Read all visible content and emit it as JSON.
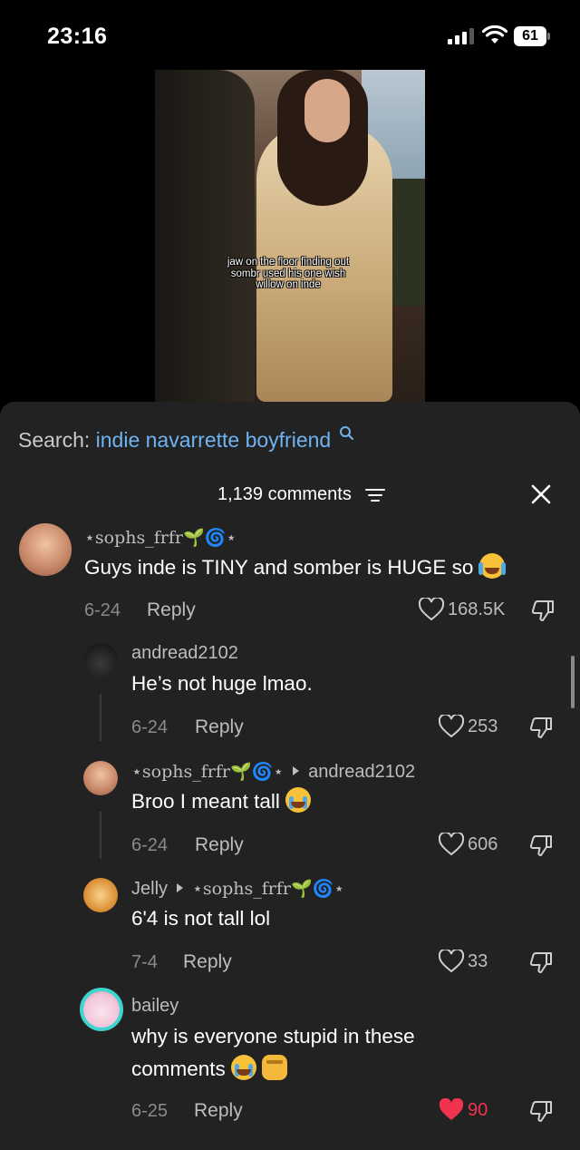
{
  "status_bar": {
    "time": "23:16",
    "battery": "61"
  },
  "video": {
    "caption": "jaw on the floor finding out sombr used his one wish willow on inde"
  },
  "search": {
    "prefix": "Search:",
    "term": "indie navarrette boyfriend"
  },
  "header": {
    "comment_count": "1,139 comments"
  },
  "comments": [
    {
      "username": "⋆sophs_frfr🌱🌀⋆",
      "text": "Guys inde is TINY and somber is HUGE so",
      "date": "6-24",
      "reply_label": "Reply",
      "likes": "168.5K",
      "avatar_color": "#d9a07f"
    },
    {
      "username": "andread2102",
      "text": "He’s not huge lmao.",
      "date": "6-24",
      "reply_label": "Reply",
      "likes": "253",
      "avatar_color": "#1a1a1a"
    },
    {
      "username": "⋆sophs_frfr🌱🌀⋆",
      "reply_to": "andread2102",
      "text": "Broo I meant tall",
      "date": "6-24",
      "reply_label": "Reply",
      "likes": "606",
      "avatar_color": "#d9a07f"
    },
    {
      "username": "Jelly",
      "reply_to": "⋆sophs_frfr🌱🌀⋆",
      "text": "6'4 is not tall lol",
      "date": "7-4",
      "reply_label": "Reply",
      "likes": "33",
      "avatar_color": "#e8a24a"
    },
    {
      "username": "bailey",
      "text": "why is everyone stupid in these comments",
      "date": "6-25",
      "reply_label": "Reply",
      "likes": "90",
      "liked": true,
      "avatar_color": "#f1c6d8"
    }
  ],
  "colors": {
    "accent_link": "#6fb3f2",
    "like_active": "#f0344e",
    "sheet_bg": "#222222"
  }
}
